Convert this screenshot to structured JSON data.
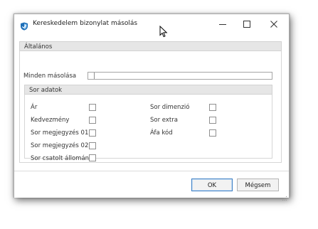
{
  "window": {
    "title": "Kereskedelem bizonylat másolás",
    "icon": "app-shield-icon",
    "controls": [
      "minimize-icon",
      "maximize-icon",
      "close-icon"
    ]
  },
  "general": {
    "header": "Általános",
    "copy_all_label": "Minden másolása",
    "copy_all_progress": 0.0
  },
  "row_data": {
    "header": "Sor adatok",
    "left_items": [
      {
        "label": "Ár",
        "checked": false
      },
      {
        "label": "Kedvezmény",
        "checked": false
      },
      {
        "label": "Sor megjegyzés 01",
        "checked": false
      },
      {
        "label": "Sor megjegyzés 02",
        "checked": false
      },
      {
        "label": "Sor csatolt állomány",
        "checked": false
      }
    ],
    "right_items": [
      {
        "label": "Sor dimenzió",
        "checked": false
      },
      {
        "label": "Sor extra",
        "checked": false
      },
      {
        "label": "Áfa kód",
        "checked": false
      }
    ]
  },
  "footer": {
    "ok_label": "OK",
    "cancel_label": "Mégsem"
  },
  "colors": {
    "accent": "#3c7fc4",
    "group_header_bg": "#e6e6e6",
    "border": "#a8a8a8"
  }
}
